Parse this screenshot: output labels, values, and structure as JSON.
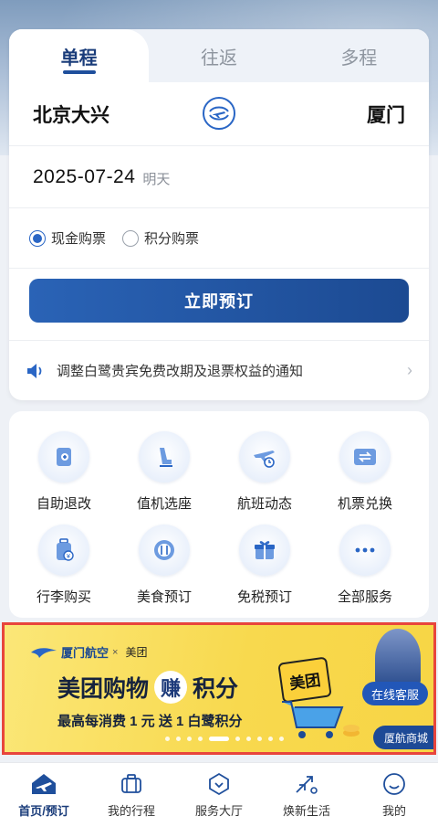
{
  "colors": {
    "primary": "#1f4f9c",
    "accent": "#2a66c5",
    "banner_bg": "#fbe15f",
    "highlight_border": "#e8453c"
  },
  "tabs": [
    {
      "label": "单程",
      "active": true
    },
    {
      "label": "往返",
      "active": false
    },
    {
      "label": "多程",
      "active": false
    }
  ],
  "route": {
    "origin": "北京大兴",
    "destination": "厦门",
    "swap_icon": "plane-swap-icon"
  },
  "date": {
    "value": "2025-07-24",
    "relative": "明天"
  },
  "payment": {
    "options": [
      {
        "label": "现金购票",
        "selected": true
      },
      {
        "label": "积分购票",
        "selected": false
      }
    ]
  },
  "book_button": "立即预订",
  "notice": {
    "icon": "speaker-icon",
    "text": "调整白鹭贵宾免费改期及退票权益的通知"
  },
  "services": [
    {
      "label": "自助退改",
      "icon": "refund-icon"
    },
    {
      "label": "值机选座",
      "icon": "seat-icon"
    },
    {
      "label": "航班动态",
      "icon": "flight-status-icon"
    },
    {
      "label": "机票兑换",
      "icon": "ticket-exchange-icon"
    },
    {
      "label": "行李购买",
      "icon": "luggage-icon"
    },
    {
      "label": "美食预订",
      "icon": "meal-icon"
    },
    {
      "label": "免税预订",
      "icon": "gift-icon"
    },
    {
      "label": "全部服务",
      "icon": "more-icon"
    }
  ],
  "banner": {
    "brand_xiamen": "厦门航空",
    "brand_x": "×",
    "brand_meituan": "美团",
    "title_left": "美团购物",
    "title_earn": "赚",
    "title_right": "积分",
    "subtitle": "最高每消费 1 元 送 1 白鹭积分",
    "meituan_logo": "美团",
    "online_service": "在线客服",
    "mall": "厦航商城",
    "carousel_count": 10,
    "carousel_active": 4
  },
  "nav": [
    {
      "label": "首页/预订",
      "icon": "home-plane-icon",
      "active": true
    },
    {
      "label": "我的行程",
      "icon": "suitcase-icon",
      "active": false
    },
    {
      "label": "服务大厅",
      "icon": "service-hall-icon",
      "active": false
    },
    {
      "label": "焕新生活",
      "icon": "lifestyle-icon",
      "active": false
    },
    {
      "label": "我的",
      "icon": "profile-icon",
      "active": false
    }
  ]
}
